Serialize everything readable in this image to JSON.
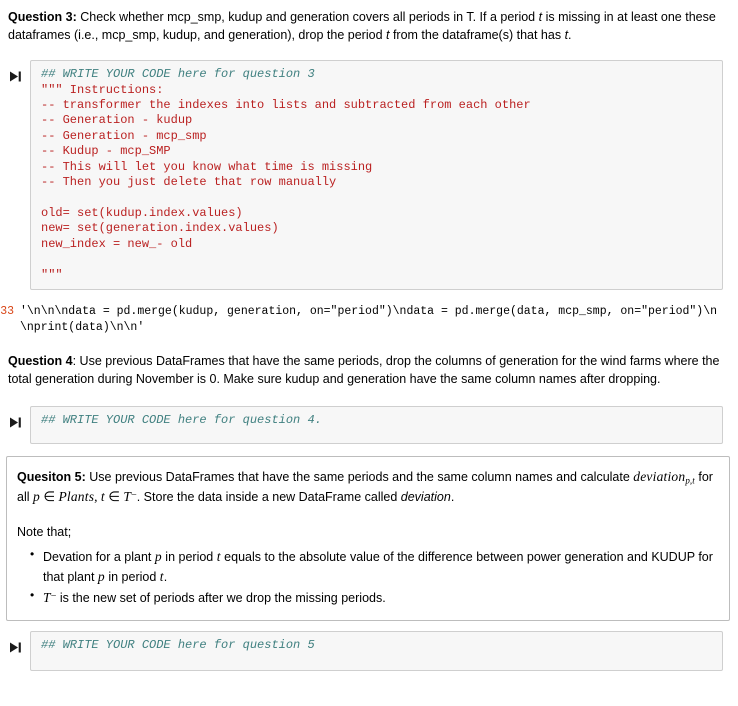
{
  "question3": {
    "label": "Question 3:",
    "text_part1": " Check whether mcp_smp, kudup and generation covers all periods in T. If a period ",
    "var_t1": "t",
    "text_part2": " is missing in at least one these dataframes (i.e., mcp_smp, kudup, and generation), drop the period ",
    "var_t2": "t",
    "text_part3": " from the dataframe(s) that has ",
    "var_t3": "t",
    "text_part4": "."
  },
  "cell3": {
    "run_icon": "step-forward-icon",
    "comment_line": "## WRITE YOUR CODE here for question 3",
    "code_body": "\"\"\" Instructions:\n-- transformer the indexes into lists and subtracted from each other\n-- Generation - kudup\n-- Generation - mcp_smp\n-- Kudup - mcp_SMP\n-- This will let you know what time is missing\n-- Then you just delete that row manually\n\nold= set(kudup.index.values)\nnew= set(generation.index.values)\nnew_index = new_- old\n\n\"\"\""
  },
  "output3": {
    "prompt": "33]:",
    "text": "'\\n\\n\\ndata = pd.merge(kudup, generation, on=\"period\")\\ndata = pd.merge(data, mcp_smp, on=\"period\")\\n\\nprint(data)\\n\\n'"
  },
  "question4": {
    "label": "Question 4",
    "text": ": Use previous DataFrames that have the same periods, drop the columns of generation for the wind farms where the total generation during November is 0. Make sure kudup and generation have the same column names after dropping."
  },
  "cell4": {
    "run_icon": "step-forward-icon",
    "comment_line": "## WRITE YOUR CODE here for question 4."
  },
  "question5": {
    "label": "Quesiton 5:",
    "text_part1": " Use previous DataFrames that have the same periods and the same column names and calculate ",
    "math_deviation": "deviation",
    "math_deviation_sub": "p,t",
    "text_part2": " for all ",
    "math_p": "p",
    "math_in1": " ∈ ",
    "math_plants": "Plants",
    "math_comma": ", ",
    "math_t": "t",
    "math_in2": " ∈ ",
    "math_T": "T",
    "math_T_sup": "−",
    "text_part3": ". Store the data inside a new DataFrame called ",
    "italic_deviation": "deviation",
    "text_part4": ".",
    "note_heading": "Note that;",
    "notes": [
      {
        "seg1": "Devation for a plant ",
        "math1": "p",
        "seg2": " in period ",
        "math2": "t",
        "seg3": " equals to the absolute value of the difference between power generation and KUDUP for that plant ",
        "math3": "p",
        "seg4": " in period ",
        "math4": "t",
        "seg5": "."
      },
      {
        "math_T": "T",
        "math_T_sup": "−",
        "seg1": " is the new set of periods after we drop the missing periods."
      }
    ]
  },
  "cell5": {
    "run_icon": "step-forward-icon",
    "comment_line": "## WRITE YOUR CODE here for question 5"
  },
  "colors": {
    "comment": "#408080",
    "string": "#ba2121",
    "prompt": "#303f9f",
    "output_prompt": "#d84315",
    "cell_bg": "#f7f7f7",
    "cell_border": "#cfcfcf",
    "box_border": "#bdbdbd"
  }
}
